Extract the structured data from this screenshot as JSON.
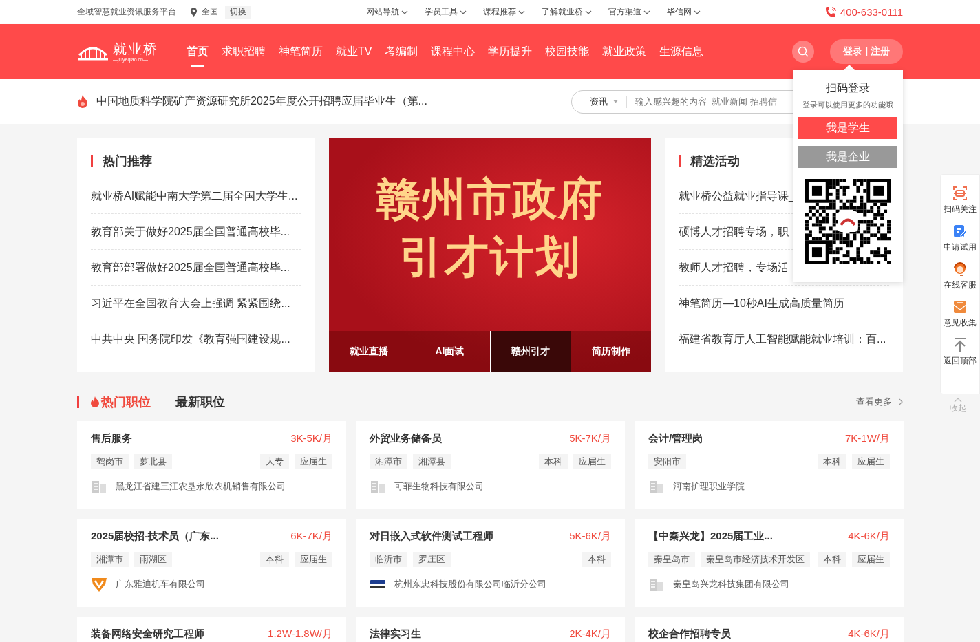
{
  "top_bar": {
    "slogan": "全域智慧就业资讯服务平台",
    "location": "全国",
    "switch": "切换",
    "menus": [
      "网站导航",
      "学员工具",
      "课程推荐",
      "了解就业桥",
      "官方渠道",
      "毕信网"
    ],
    "phone": "400-633-0111"
  },
  "nav": {
    "logo_name": "就业桥",
    "logo_domain": "—jiuyeqiao.cn—",
    "login_button": "登录 | 注册",
    "items": [
      {
        "label": "首页",
        "selected": true
      },
      {
        "label": "求职招聘",
        "selected": false
      },
      {
        "label": "神笔简历",
        "selected": false
      },
      {
        "label": "就业TV",
        "selected": false
      },
      {
        "label": "考编制",
        "selected": false
      },
      {
        "label": "课程中心",
        "selected": false
      },
      {
        "label": "学历提升",
        "selected": false
      },
      {
        "label": "校园技能",
        "selected": false
      },
      {
        "label": "就业政策",
        "selected": false
      },
      {
        "label": "生源信息",
        "selected": false
      }
    ]
  },
  "notice": {
    "text": "中国地质科学院矿产资源研究所2025年度公开招聘应届毕业生（第..."
  },
  "search": {
    "category": "资讯",
    "placeholder": "输入感兴趣的内容  就业新闻 招聘信"
  },
  "hot": {
    "title": "热门推荐",
    "items": [
      "就业桥AI赋能中南大学第二届全国大学生...",
      "教育部关于做好2025届全国普通高校毕...",
      "教育部部署做好2025届全国普通高校毕...",
      "习近平在全国教育大会上强调 紧紧围绕...",
      "中共中央 国务院印发《教育强国建设规..."
    ]
  },
  "banner": {
    "lines": [
      "赣州市政府",
      "引才计划"
    ],
    "tabs": [
      {
        "label": "就业直播",
        "selected": false
      },
      {
        "label": "AI面试",
        "selected": false
      },
      {
        "label": "赣州引才",
        "selected": true
      },
      {
        "label": "简历制作",
        "selected": false
      }
    ]
  },
  "activities": {
    "title": "精选活动",
    "items": [
      "就业桥公益就业指导课_",
      "硕博人才招聘专场，职",
      "教师人才招聘，专场活",
      "神笔简历—10秒AI生成高质量简历",
      "福建省教育厅人工智能赋能就业培训：百..."
    ]
  },
  "jobs": {
    "more": "查看更多",
    "tabs": [
      {
        "label": "热门职位",
        "selected": true
      },
      {
        "label": "最新职位",
        "selected": false
      }
    ],
    "cards": [
      {
        "title": "售后服务",
        "salary": "3K-5K/月",
        "locations": [
          "鹤岗市",
          "萝北县"
        ],
        "tags": [
          "大专",
          "应届生"
        ],
        "company": "黑龙江省建三江农垦永欣农机销售有限公司",
        "kind": "building"
      },
      {
        "title": "外贸业务储备员",
        "salary": "5K-7K/月",
        "locations": [
          "湘潭市",
          "湘潭县"
        ],
        "tags": [
          "本科",
          "应届生"
        ],
        "company": "可菲生物科技有限公司",
        "kind": "building"
      },
      {
        "title": "会计/管理岗",
        "salary": "7K-1W/月",
        "locations": [
          "安阳市"
        ],
        "tags": [
          "本科",
          "应届生"
        ],
        "company": "河南护理职业学院",
        "kind": "building"
      },
      {
        "title": "2025届校招-技术员（广东...",
        "salary": "6K-7K/月",
        "locations": [
          "湘潭市",
          "雨湖区"
        ],
        "tags": [
          "本科",
          "应届生"
        ],
        "company": "广东雅迪机车有限公司",
        "kind": "shield"
      },
      {
        "title": "对日嵌入式软件测试工程师",
        "salary": "5K-6K/月",
        "locations": [
          "临沂市",
          "罗庄区"
        ],
        "tags": [
          "本科"
        ],
        "company": "杭州东忠科技股份有限公司临沂分公司",
        "kind": "wordmark"
      },
      {
        "title": "【中秦兴龙】2025届工业...",
        "salary": "4K-6K/月",
        "locations": [
          "秦皇岛市",
          "秦皇岛市经济技术开发区"
        ],
        "tags": [
          "本科",
          "应届生"
        ],
        "company": "秦皇岛兴龙科技集团有限公司",
        "kind": "building"
      },
      {
        "title": "装备网络安全研究工程师",
        "salary": "1.2W-1.8W/月"
      },
      {
        "title": "法律实习生",
        "salary": "2K-4K/月"
      },
      {
        "title": "校企合作招聘专员",
        "salary": "4K-6K/月"
      }
    ]
  },
  "popup": {
    "title": "扫码登录",
    "subtitle": "登录可以使用更多的功能哦",
    "buttons": [
      {
        "label": "我是学生",
        "kind": "primary"
      },
      {
        "label": "我是企业",
        "kind": "secondary"
      }
    ]
  },
  "side": {
    "items": [
      "扫码关注",
      "申请试用",
      "在线客服",
      "意见收集",
      "返回顶部"
    ],
    "collapse": "收起"
  }
}
